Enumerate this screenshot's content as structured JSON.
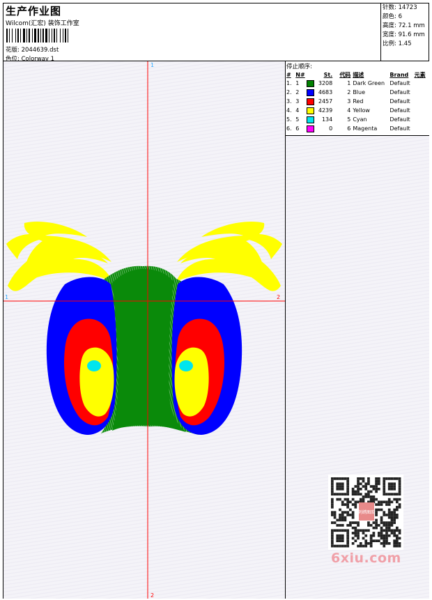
{
  "header": {
    "title": "生产作业图",
    "company": "Wilcom(汇宏) 装饰工作室",
    "design_label": "花版:",
    "design_file": "2044639.dst",
    "colorway_label": "色位:",
    "colorway": "Colorway 1"
  },
  "stats": [
    {
      "label": "针数:",
      "value": "14723"
    },
    {
      "label": "颜色:",
      "value": "6"
    },
    {
      "label": "高度:",
      "value": "72.1 mm"
    },
    {
      "label": "宽度:",
      "value": "91.6 mm"
    },
    {
      "label": "比例:",
      "value": "1.45"
    }
  ],
  "stop_sequence": {
    "title": "停止顺序:",
    "columns": [
      "#",
      "N#",
      "St.",
      "代码",
      "描述",
      "Brand",
      "元素"
    ],
    "rows": [
      {
        "num": "1.",
        "n": "1",
        "color": "#008000",
        "stitches": "3208",
        "code": "1",
        "desc": "Dark Green",
        "brand": "Default"
      },
      {
        "num": "2.",
        "n": "2",
        "color": "#0000ff",
        "stitches": "4683",
        "code": "2",
        "desc": "Blue",
        "brand": "Default"
      },
      {
        "num": "3.",
        "n": "3",
        "color": "#ff0000",
        "stitches": "2457",
        "code": "3",
        "desc": "Red",
        "brand": "Default"
      },
      {
        "num": "4.",
        "n": "4",
        "color": "#ffff00",
        "stitches": "4239",
        "code": "4",
        "desc": "Yellow",
        "brand": "Default"
      },
      {
        "num": "5.",
        "n": "5",
        "color": "#00e5ee",
        "stitches": "134",
        "code": "5",
        "desc": "Cyan",
        "brand": "Default"
      },
      {
        "num": "6.",
        "n": "6",
        "color": "#ff00ff",
        "stitches": "0",
        "code": "6",
        "desc": "Magenta",
        "brand": "Default"
      }
    ]
  },
  "axes": {
    "top": "1",
    "bottom": "2",
    "left": "1",
    "right": "2"
  },
  "watermark": "6xiu.com",
  "qr_badge": "刺绣图库"
}
